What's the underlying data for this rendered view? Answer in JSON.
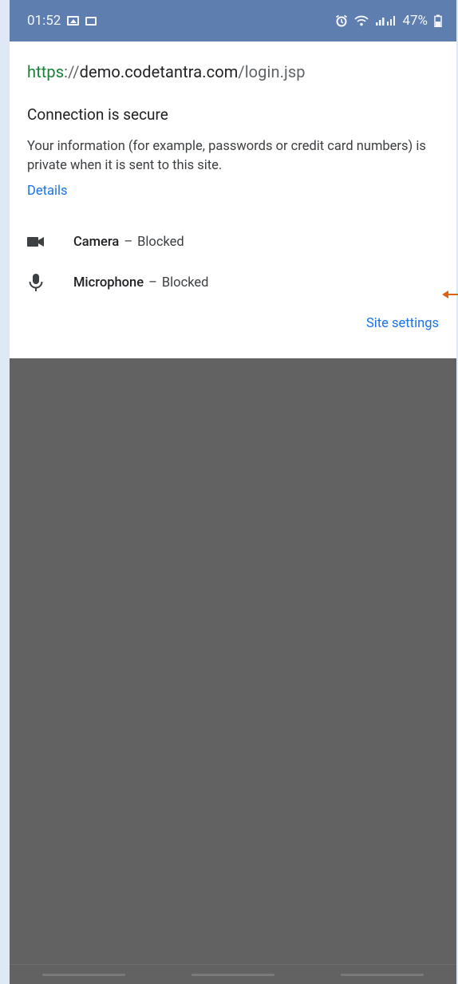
{
  "status_bar": {
    "time": "01:52",
    "battery": "47%"
  },
  "panel": {
    "url_scheme": "https",
    "url_sep": "://",
    "url_host": "demo.codetantra.com",
    "url_path": "/login.jsp",
    "connection_title": "Connection is secure",
    "description": "Your information (for example, passwords or credit card numbers) is private when it is sent to this site.",
    "details_link": "Details",
    "permissions": [
      {
        "name": "Camera",
        "separator": "–",
        "state": "Blocked",
        "icon": "videocam-icon"
      },
      {
        "name": "Microphone",
        "separator": "–",
        "state": "Blocked",
        "icon": "microphone-icon"
      }
    ],
    "site_settings_label": "Site settings"
  },
  "colors": {
    "status_bar_bg": "#5f7eb0",
    "secure_green": "#188038",
    "link_blue": "#1a73e8",
    "arrow_orange": "#d9640f",
    "scrim": "#626262"
  }
}
